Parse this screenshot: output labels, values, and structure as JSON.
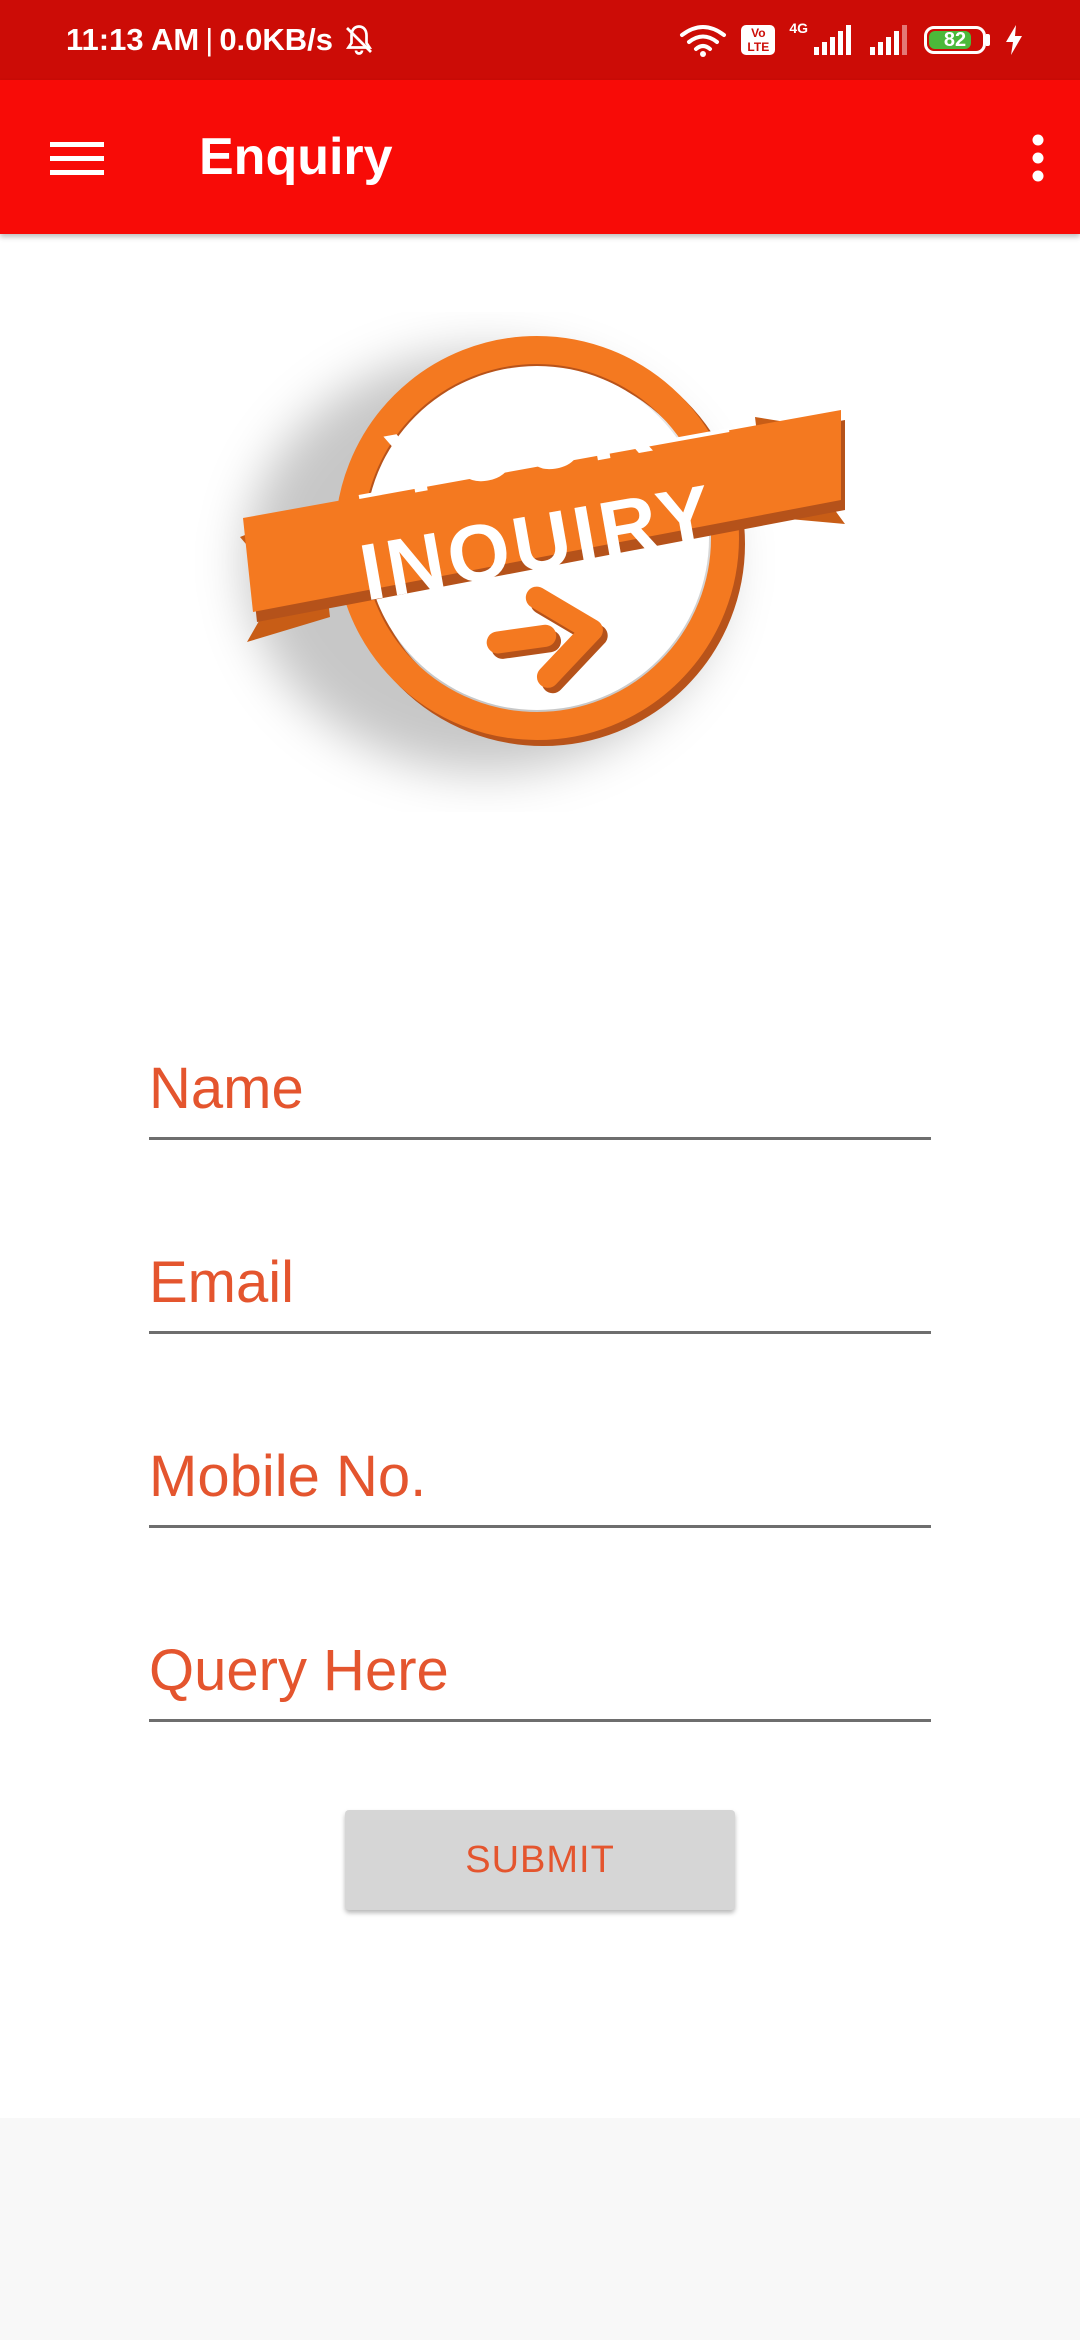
{
  "status_bar": {
    "time": "11:13 AM",
    "separator": "|",
    "speed": "0.0KB/s",
    "volte_top": "Vo",
    "volte_bottom": "LTE",
    "network_type": "4G",
    "battery_level": "82",
    "battery_percent": 82,
    "icons": [
      "bell-off-icon",
      "wifi-icon",
      "volte-icon",
      "signal-icon",
      "signal-icon",
      "battery-icon",
      "charging-icon"
    ]
  },
  "app_bar": {
    "title": "Enquiry",
    "menu_icon": "hamburger-menu-icon",
    "overflow_icon": "more-vertical-icon"
  },
  "logo": {
    "line1": "YOUR",
    "line2": "INQUIRY",
    "arrow_icon": "arrow-right-icon"
  },
  "form": {
    "name_placeholder": "Name",
    "email_placeholder": "Email",
    "mobile_placeholder": "Mobile No.",
    "query_placeholder": "Query Here",
    "submit_label": "SUBMIT"
  },
  "colors": {
    "status_bar": "#cc0c06",
    "app_bar": "#f80b07",
    "accent": "#e4552e",
    "logo_orange": "#f47920",
    "button_bg": "#d6d6d6"
  }
}
